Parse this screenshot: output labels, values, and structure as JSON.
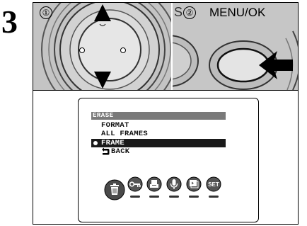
{
  "step": {
    "number": "3"
  },
  "panels": {
    "left": {
      "index": "①"
    },
    "right": {
      "index": "②",
      "partial_label": "S",
      "button_label": "MENU/OK"
    }
  },
  "lcd_menu": {
    "header": "ERASE",
    "items": [
      {
        "label": "FORMAT",
        "selected": false
      },
      {
        "label": "ALL FRAMES",
        "selected": false
      },
      {
        "label": "FRAME",
        "selected": true
      },
      {
        "label": "BACK",
        "selected": false,
        "icon": "return-arrow-icon"
      }
    ],
    "mode_icons": [
      "trash-icon",
      "protect-key-icon",
      "print-order-icon",
      "voice-memo-icon",
      "slideshow-icon",
      "set-icon"
    ],
    "mode_icon_labels": {
      "set": "SET"
    }
  },
  "colors": {
    "panel_gray": "#c8c8c8",
    "menu_selected": "#1a1a1a",
    "header_gray": "#7a7a7a"
  }
}
